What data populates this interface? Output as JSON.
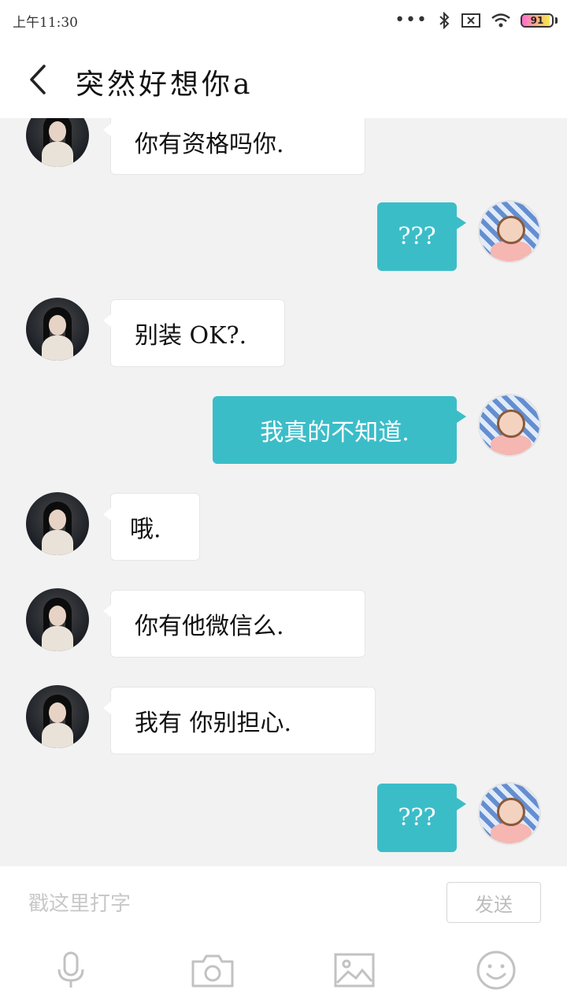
{
  "status": {
    "time": "上午11:30",
    "battery": "91",
    "battery_level": 0.91
  },
  "header": {
    "title": "突然好想你a"
  },
  "messages": [
    {
      "side": "left",
      "text": "你有资格吗你."
    },
    {
      "side": "right",
      "text": "???"
    },
    {
      "side": "left",
      "text": "别装 OK?."
    },
    {
      "side": "right",
      "text": "我真的不知道."
    },
    {
      "side": "left",
      "text": "哦."
    },
    {
      "side": "left",
      "text": "你有他微信么."
    },
    {
      "side": "left",
      "text": "我有 你别担心."
    },
    {
      "side": "right",
      "text": "???"
    }
  ],
  "input": {
    "placeholder": "戳这里打字",
    "value": "",
    "send_label": "发送"
  },
  "toolbar": {
    "items": [
      "microphone-icon",
      "camera-icon",
      "image-icon",
      "emoji-icon"
    ]
  },
  "colors": {
    "accent": "#3bbdc8",
    "background": "#f2f2f2"
  }
}
